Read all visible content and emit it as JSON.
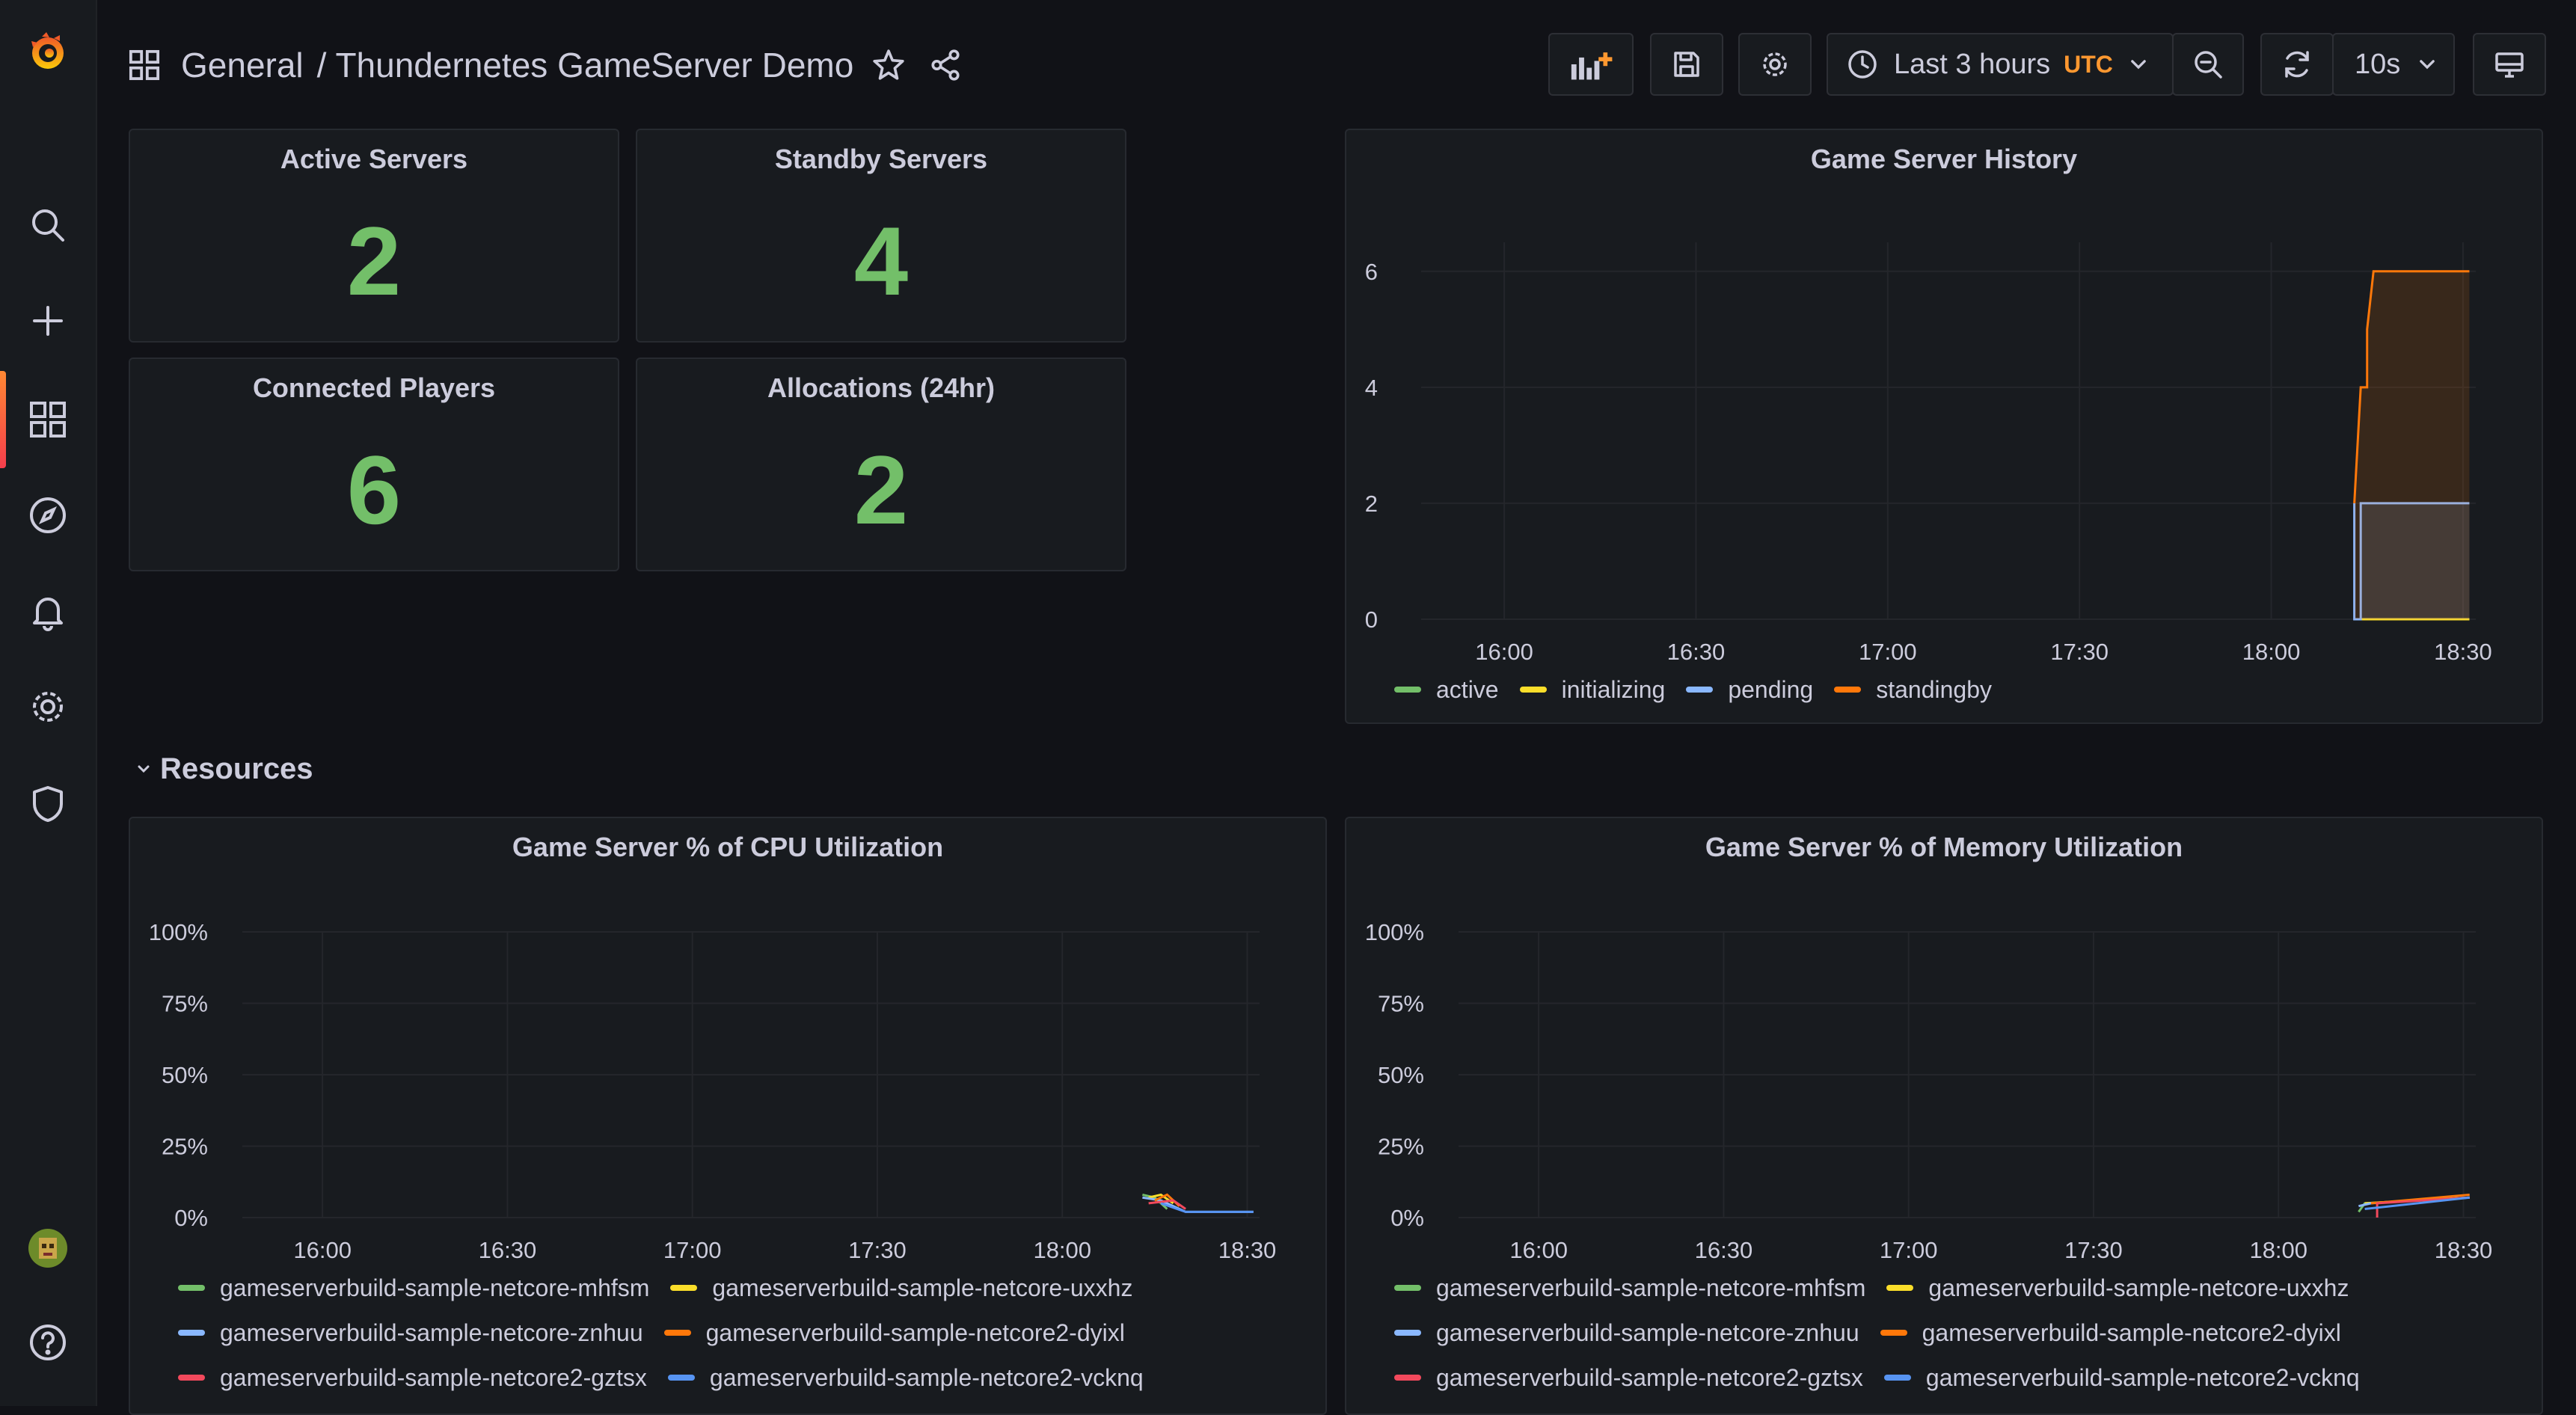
{
  "breadcrumb": {
    "folder": "General",
    "separator": "/",
    "dashboard": "Thundernetes GameServer Demo"
  },
  "toolbar": {
    "time_range": "Last 3 hours",
    "timezone": "UTC",
    "refresh_interval": "10s"
  },
  "stats": [
    {
      "title": "Active Servers",
      "value": "2"
    },
    {
      "title": "Standby Servers",
      "value": "4"
    },
    {
      "title": "Connected Players",
      "value": "6"
    },
    {
      "title": "Allocations (24hr)",
      "value": "2"
    }
  ],
  "row": {
    "title": "Resources"
  },
  "history_panel": {
    "title": "Game Server History"
  },
  "cpu_panel": {
    "title": "Game Server % of CPU Utilization"
  },
  "mem_panel": {
    "title": "Game Server % of Memory Utilization"
  },
  "colors": {
    "green": "#73bf69",
    "yellow": "#fade2a",
    "blue": "#8ab8ff",
    "orange": "#ff780a",
    "red": "#f2495c",
    "blue2": "#5794f2",
    "brand_orange": "#ff8833"
  },
  "chart_data": [
    {
      "type": "area",
      "title": "Game Server History",
      "x": [
        "16:00",
        "16:30",
        "17:00",
        "17:30",
        "18:00",
        "18:30"
      ],
      "yticks": [
        "0",
        "2",
        "4",
        "6"
      ],
      "ylim": [
        0,
        6.5
      ],
      "xlim": [
        "15:47",
        "18:32"
      ],
      "legend_position": "bottom",
      "series": [
        {
          "name": "active",
          "color": "#73bf69",
          "points": [
            [
              "18:13",
              0
            ],
            [
              "18:31",
              0
            ]
          ]
        },
        {
          "name": "initializing",
          "color": "#fade2a",
          "points": [
            [
              "18:13",
              0
            ],
            [
              "18:31",
              0
            ]
          ]
        },
        {
          "name": "pending",
          "color": "#8ab8ff",
          "points": [
            [
              "18:13",
              2
            ],
            [
              "18:13",
              0
            ],
            [
              "18:14",
              0
            ],
            [
              "18:14",
              2
            ],
            [
              "18:31",
              2
            ]
          ]
        },
        {
          "name": "standingby",
          "color": "#ff780a",
          "points": [
            [
              "18:13",
              2
            ],
            [
              "18:14",
              4
            ],
            [
              "18:15",
              4
            ],
            [
              "18:15",
              5
            ],
            [
              "18:16",
              6
            ],
            [
              "18:31",
              6
            ]
          ]
        }
      ]
    },
    {
      "type": "line",
      "title": "Game Server % of CPU Utilization",
      "x": [
        "16:00",
        "16:30",
        "17:00",
        "17:30",
        "18:00",
        "18:30"
      ],
      "yticks": [
        "0%",
        "25%",
        "50%",
        "75%",
        "100%"
      ],
      "ylim": [
        0,
        100
      ],
      "xlim": [
        "15:47",
        "18:32"
      ],
      "legend_position": "bottom",
      "series": [
        {
          "name": "gameserverbuild-sample-netcore-mhfsm",
          "color": "#73bf69",
          "points": [
            [
              "18:13",
              8
            ],
            [
              "18:15",
              7
            ],
            [
              "18:17",
              3
            ]
          ]
        },
        {
          "name": "gameserverbuild-sample-netcore-uxxhz",
          "color": "#fade2a",
          "points": [
            [
              "18:14",
              7
            ],
            [
              "18:16",
              8
            ],
            [
              "18:18",
              5
            ]
          ]
        },
        {
          "name": "gameserverbuild-sample-netcore-znhuu",
          "color": "#8ab8ff",
          "points": [
            [
              "18:13",
              7
            ],
            [
              "18:16",
              6
            ],
            [
              "18:20",
              2
            ],
            [
              "18:31",
              2
            ]
          ]
        },
        {
          "name": "gameserverbuild-sample-netcore2-dyixl",
          "color": "#ff780a",
          "points": [
            [
              "18:15",
              6
            ],
            [
              "18:17",
              8
            ],
            [
              "18:19",
              4
            ]
          ]
        },
        {
          "name": "gameserverbuild-sample-netcore2-gztsx",
          "color": "#f2495c",
          "points": [
            [
              "18:14",
              5
            ],
            [
              "18:18",
              6
            ],
            [
              "18:20",
              3
            ]
          ]
        },
        {
          "name": "gameserverbuild-sample-netcore2-vcknq",
          "color": "#5794f2",
          "points": [
            [
              "18:16",
              5
            ],
            [
              "18:20",
              2
            ],
            [
              "18:31",
              2
            ]
          ]
        }
      ]
    },
    {
      "type": "line",
      "title": "Game Server % of Memory Utilization",
      "x": [
        "16:00",
        "16:30",
        "17:00",
        "17:30",
        "18:00",
        "18:30"
      ],
      "yticks": [
        "0%",
        "25%",
        "50%",
        "75%",
        "100%"
      ],
      "ylim": [
        0,
        100
      ],
      "xlim": [
        "15:47",
        "18:32"
      ],
      "legend_position": "bottom",
      "series": [
        {
          "name": "gameserverbuild-sample-netcore-mhfsm",
          "color": "#73bf69",
          "points": [
            [
              "18:13",
              2
            ],
            [
              "18:14",
              5
            ],
            [
              "18:31",
              7
            ]
          ]
        },
        {
          "name": "gameserverbuild-sample-netcore-uxxhz",
          "color": "#fade2a",
          "points": [
            [
              "18:14",
              5
            ],
            [
              "18:31",
              7
            ]
          ]
        },
        {
          "name": "gameserverbuild-sample-netcore-znhuu",
          "color": "#8ab8ff",
          "points": [
            [
              "18:13",
              4
            ],
            [
              "18:15",
              5
            ],
            [
              "18:31",
              7
            ]
          ]
        },
        {
          "name": "gameserverbuild-sample-netcore2-dyixl",
          "color": "#ff780a",
          "points": [
            [
              "18:15",
              5
            ],
            [
              "18:31",
              8
            ]
          ]
        },
        {
          "name": "gameserverbuild-sample-netcore2-gztsx",
          "color": "#f2495c",
          "points": [
            [
              "18:16",
              0
            ],
            [
              "18:16",
              5
            ],
            [
              "18:31",
              7
            ]
          ]
        },
        {
          "name": "gameserverbuild-sample-netcore2-vcknq",
          "color": "#5794f2",
          "points": [
            [
              "18:14",
              3
            ],
            [
              "18:31",
              7
            ]
          ]
        }
      ]
    }
  ]
}
